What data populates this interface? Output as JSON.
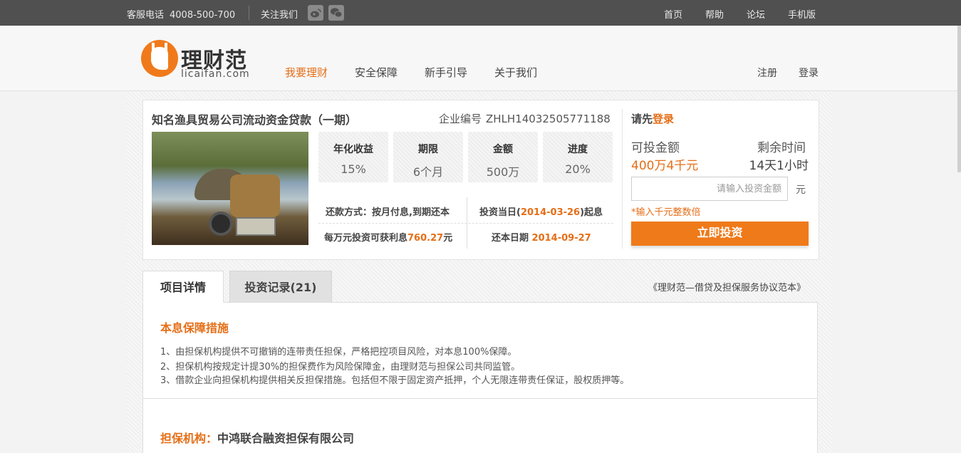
{
  "topbar": {
    "hotline_label": "客服电话",
    "hotline_number": "4008-500-700",
    "follow_label": "关注我们",
    "weibo_icon": "weibo-icon",
    "wechat_icon": "wechat-icon",
    "nav": [
      "首页",
      "帮助",
      "论坛",
      "手机版"
    ]
  },
  "header": {
    "logo_cn": "理财范",
    "logo_en": "licaifan.com",
    "nav": [
      "我要理财",
      "安全保障",
      "新手引导",
      "关于我们"
    ],
    "active_nav": "我要理财",
    "register": "注册",
    "login": "登录"
  },
  "project": {
    "title": "知名渔具贸易公司流动资金贷款（一期）",
    "code_label": "企业编号",
    "code": "ZHLH14032505771188",
    "stats": [
      {
        "label": "年化收益",
        "value": "15%"
      },
      {
        "label": "期限",
        "value": "6个月"
      },
      {
        "label": "金额",
        "value": "500万"
      },
      {
        "label": "进度",
        "value": "20%"
      }
    ],
    "repay_label": "还款方式：",
    "repay_value": "按月付息,到期还本",
    "start_prefix": "投资当日(",
    "start_date": "2014-03-26",
    "start_suffix": ")起息",
    "interest_prefix": "每万元投资可获利息",
    "interest_value": "760.27",
    "interest_unit": "元",
    "end_label": "还本日期",
    "end_date": "2014-09-27"
  },
  "invest": {
    "prompt_prefix": "请先",
    "prompt_link": "登录",
    "available_label": "可投金额",
    "available_value": "400万4千元",
    "remaining_label": "剩余时间",
    "remaining_value": "14天1小时",
    "input_placeholder": "请输入投资金额",
    "unit": "元",
    "hint": "*输入千元整数倍",
    "button": "立即投资"
  },
  "tabs": {
    "details": "项目详情",
    "records": "投资记录(21)",
    "agreement": "《理财范—借贷及担保服务协议范本》"
  },
  "guarantee": {
    "heading": "本息保障措施",
    "lines": [
      "1、由担保机构提供不可撤销的连带责任担保，严格把控项目风险，对本息100%保障。",
      "2、担保机构按规定计提30%的担保费作为风险保障金，由理财范与担保公司共同监管。",
      "3、借款企业向担保机构提供相关反担保措施。包括但不限于固定资产抵押，个人无限连带责任保证，股权质押等。"
    ],
    "agency_label": "担保机构：",
    "agency_value": "中鸿联合融资担保有限公司"
  },
  "colors": {
    "accent": "#ef7a1a",
    "topbar": "#505050"
  }
}
